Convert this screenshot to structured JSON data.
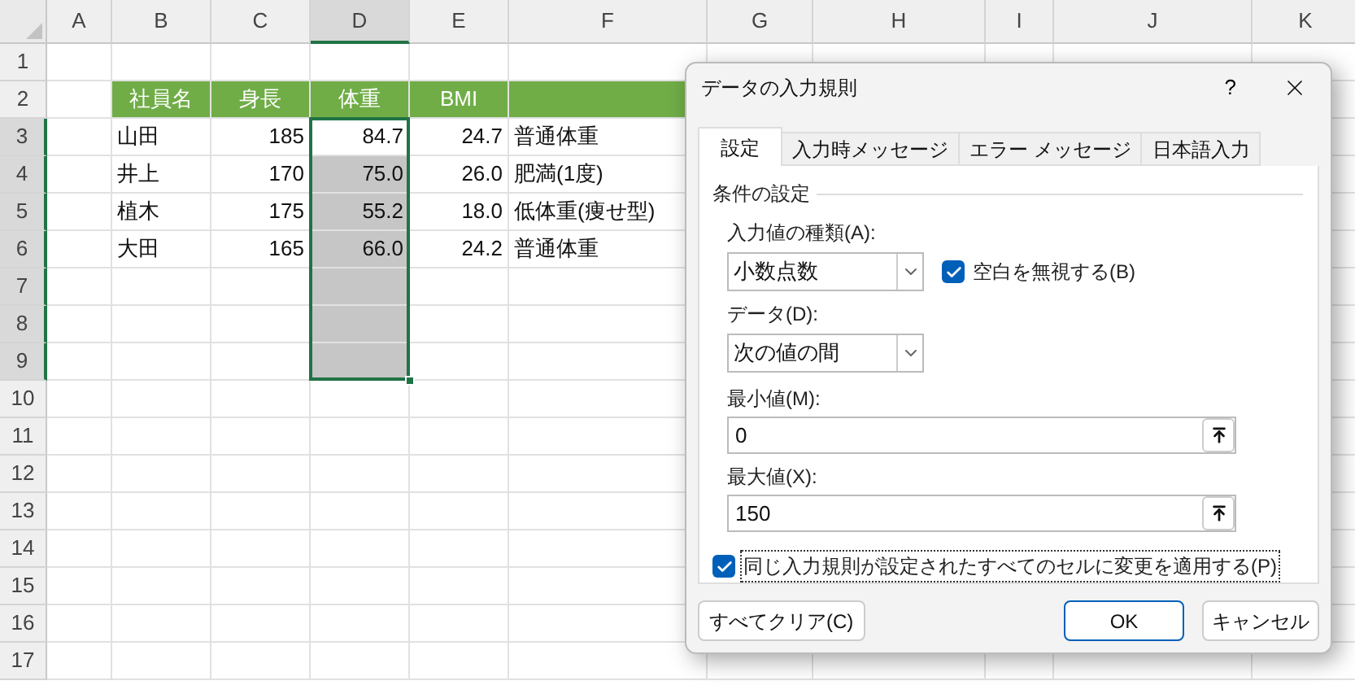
{
  "sheet": {
    "columns": [
      {
        "label": "A",
        "selected": false
      },
      {
        "label": "B",
        "selected": false
      },
      {
        "label": "C",
        "selected": false
      },
      {
        "label": "D",
        "selected": true
      },
      {
        "label": "E",
        "selected": false
      },
      {
        "label": "F",
        "selected": false
      },
      {
        "label": "G",
        "selected": false
      },
      {
        "label": "H",
        "selected": false
      },
      {
        "label": "I",
        "selected": false
      },
      {
        "label": "J",
        "selected": false
      },
      {
        "label": "K",
        "selected": false
      }
    ],
    "rows": [
      {
        "label": "1",
        "kind": "blank",
        "selected": false
      },
      {
        "label": "2",
        "kind": "header",
        "selected": false,
        "cells": [
          "社員名",
          "身長",
          "体重",
          "BMI"
        ]
      },
      {
        "label": "3",
        "kind": "data",
        "selected": true,
        "cells": [
          "山田",
          "185",
          "84.7",
          "24.7",
          "普通体重"
        ]
      },
      {
        "label": "4",
        "kind": "data",
        "selected": true,
        "cells": [
          "井上",
          "170",
          "75.0",
          "26.0",
          "肥満(1度)"
        ]
      },
      {
        "label": "5",
        "kind": "data",
        "selected": true,
        "cells": [
          "植木",
          "175",
          "55.2",
          "18.0",
          "低体重(痩せ型)"
        ]
      },
      {
        "label": "6",
        "kind": "data",
        "selected": true,
        "cells": [
          "大田",
          "165",
          "66.0",
          "24.2",
          "普通体重"
        ]
      },
      {
        "label": "7",
        "kind": "blank",
        "selected": true
      },
      {
        "label": "8",
        "kind": "blank",
        "selected": true
      },
      {
        "label": "9",
        "kind": "blank",
        "selected": true
      },
      {
        "label": "10",
        "kind": "blank",
        "selected": false
      },
      {
        "label": "11",
        "kind": "blank",
        "selected": false
      },
      {
        "label": "12",
        "kind": "blank",
        "selected": false
      },
      {
        "label": "13",
        "kind": "blank",
        "selected": false
      },
      {
        "label": "14",
        "kind": "blank",
        "selected": false
      },
      {
        "label": "15",
        "kind": "blank",
        "selected": false
      },
      {
        "label": "16",
        "kind": "blank",
        "selected": false
      },
      {
        "label": "17",
        "kind": "blank",
        "selected": false
      }
    ]
  },
  "dialog": {
    "title": "データの入力規則",
    "help": "?",
    "tabs": [
      {
        "label": "設定",
        "selected": true
      },
      {
        "label": "入力時メッセージ",
        "selected": false
      },
      {
        "label": "エラー メッセージ",
        "selected": false
      },
      {
        "label": "日本語入力",
        "selected": false
      }
    ],
    "section": "条件の設定",
    "allow": {
      "label": "入力値の種類(A):",
      "value": "小数点数"
    },
    "ignore_blank": {
      "label": "空白を無視する(B)",
      "checked": true
    },
    "data": {
      "label": "データ(D):",
      "value": "次の値の間"
    },
    "minimum": {
      "label": "最小値(M):",
      "value": "0"
    },
    "maximum": {
      "label": "最大値(X):",
      "value": "150"
    },
    "apply_all": {
      "label": "同じ入力規則が設定されたすべてのセルに変更を適用する(P)",
      "checked": true
    },
    "buttons": [
      {
        "label": "すべてクリア(C)",
        "kind": "clear"
      },
      {
        "label": "OK",
        "kind": "default"
      },
      {
        "label": "キャンセル",
        "kind": "cancel"
      }
    ]
  }
}
